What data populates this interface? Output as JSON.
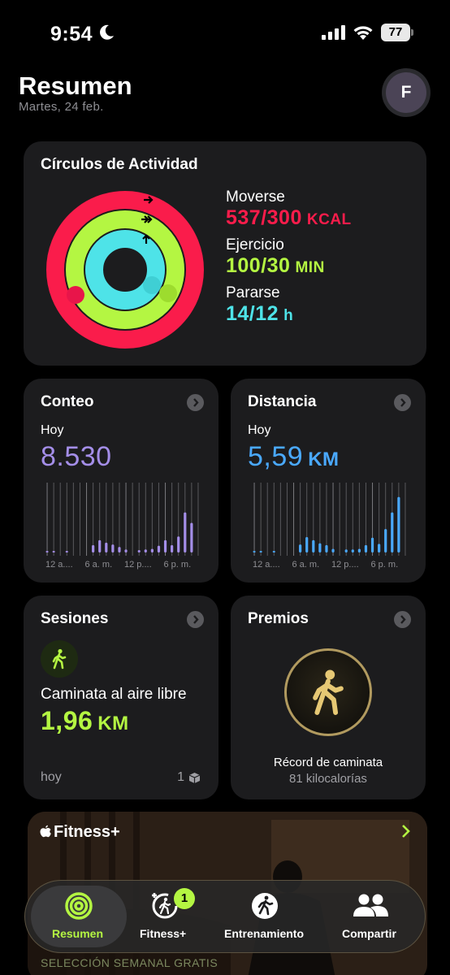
{
  "status_bar": {
    "time": "9:54",
    "battery": "77"
  },
  "header": {
    "title": "Resumen",
    "date": "Martes, 24 feb.",
    "avatar_initial": "F"
  },
  "activity": {
    "title": "Círculos de Actividad",
    "move": {
      "label": "Moverse",
      "value": "537/300",
      "unit": "KCAL",
      "color": "#fa1c4b",
      "progress": 1.79
    },
    "exercise": {
      "label": "Ejercicio",
      "value": "100/30",
      "unit": "MIN",
      "color": "#b4f642",
      "progress": 3.33
    },
    "stand": {
      "label": "Pararse",
      "value": "14/12",
      "unit": "h",
      "color": "#4ee3e8",
      "progress": 1.17
    }
  },
  "steps": {
    "title": "Conteo",
    "period": "Hoy",
    "value": "8.530",
    "unit": "",
    "color": "#a48ee8",
    "axis_labels": [
      "12 a....",
      "6 a. m.",
      "12 p....",
      "6 p. m."
    ],
    "hourly": [
      0.02,
      0.02,
      0,
      0.02,
      0,
      0,
      0,
      0.12,
      0.2,
      0.16,
      0.13,
      0.09,
      0.05,
      0,
      0.04,
      0.05,
      0.06,
      0.11,
      0.2,
      0.12,
      0.26,
      0.65,
      0.48,
      0
    ]
  },
  "distance": {
    "title": "Distancia",
    "period": "Hoy",
    "value": "5,59",
    "unit": "KM",
    "color": "#4aa9ff",
    "axis_labels": [
      "12 a....",
      "6 a. m.",
      "12 p....",
      "6 p. m."
    ],
    "hourly": [
      0.02,
      0.02,
      0,
      0.02,
      0,
      0,
      0,
      0.13,
      0.25,
      0.2,
      0.15,
      0.12,
      0.06,
      0,
      0.05,
      0.05,
      0.06,
      0.12,
      0.24,
      0.14,
      0.38,
      0.65,
      0.9,
      0
    ]
  },
  "sessions": {
    "title": "Sesiones",
    "workout_name": "Caminata al aire libre",
    "value": "1,96",
    "unit": "KM",
    "day": "hoy",
    "count": "1"
  },
  "awards": {
    "title": "Premios",
    "award_title": "Récord de caminata",
    "award_sub": "81 kilocalorías"
  },
  "fitness_plus": {
    "title": "Fitness+",
    "selection_text": "SELECCIÓN SEMANAL GRATIS"
  },
  "tabbar": {
    "tabs": [
      {
        "label": "Resumen",
        "active": true
      },
      {
        "label": "Fitness+",
        "badge": "1"
      },
      {
        "label": "Entrenamiento"
      },
      {
        "label": "Compartir"
      }
    ]
  }
}
